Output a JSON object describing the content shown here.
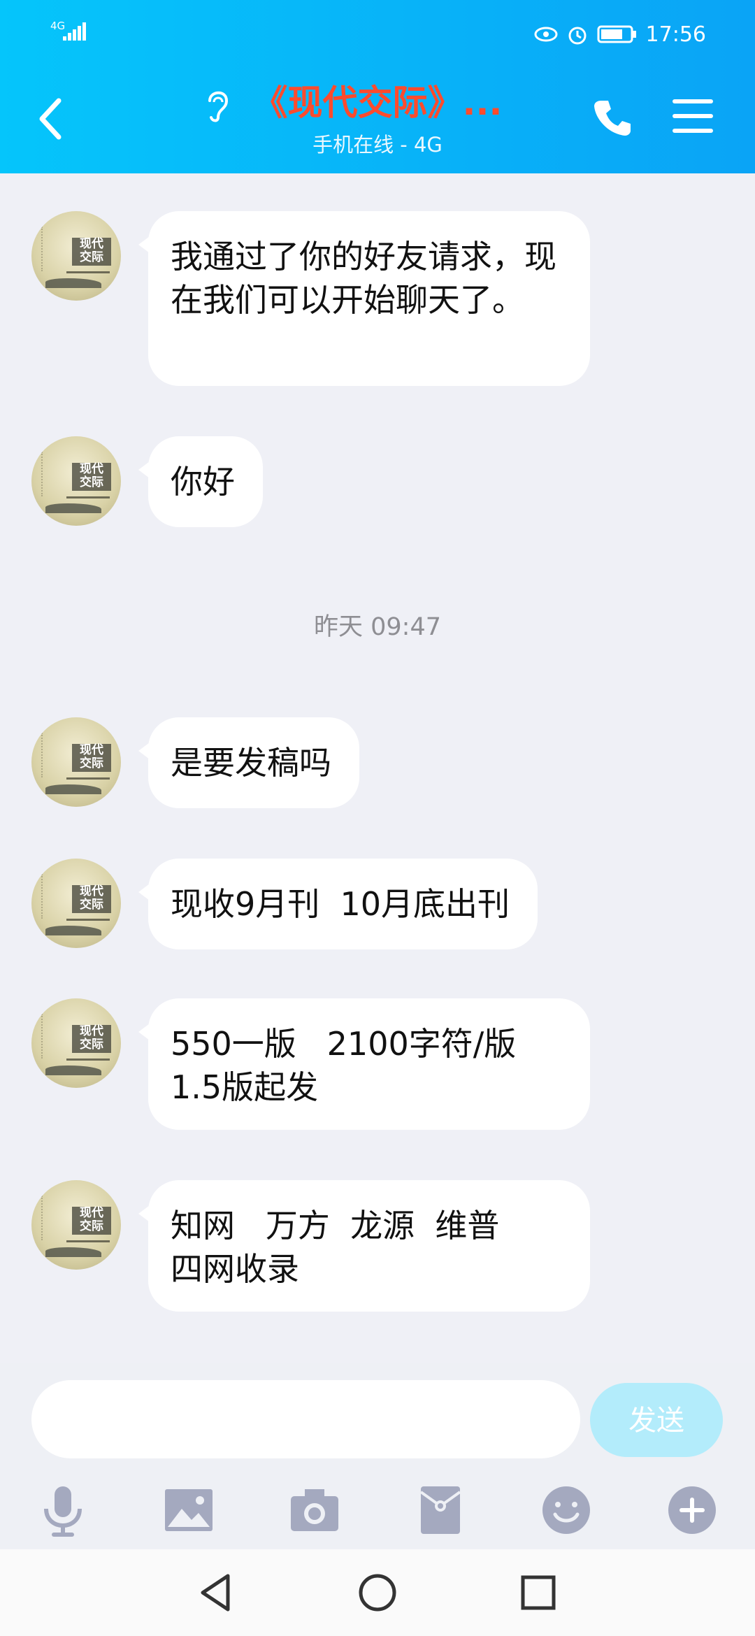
{
  "status_bar": {
    "signal": "4G",
    "time": "17:56"
  },
  "header": {
    "title": "《现代交际》...",
    "subtitle": "手机在线 - 4G"
  },
  "avatar_text": {
    "line1": "现代",
    "line2": "交际"
  },
  "messages": [
    {
      "text": "我通过了你的好友请求，现在我们可以开始聊天了。"
    },
    {
      "text": "你好"
    },
    {
      "text": "是要发稿吗"
    },
    {
      "text": "现收9月刊  10月底出刊"
    },
    {
      "text": "550一版   2100字符/版\n1.5版起发"
    },
    {
      "text": "知网   万方  龙源  维普\n四网收录"
    }
  ],
  "timestamp": "昨天 09:47",
  "composer": {
    "placeholder": "",
    "send_label": "发送"
  },
  "toolbar_icons": [
    "microphone-icon",
    "image-icon",
    "camera-icon",
    "red-packet-icon",
    "emoji-icon",
    "plus-icon"
  ],
  "colors": {
    "header_start": "#05c5fb",
    "header_end": "#0aa4f6",
    "title": "#ff4b2d",
    "background": "#eff0f6",
    "send": "#b3ecfb",
    "icon": "#a4a9bf"
  }
}
